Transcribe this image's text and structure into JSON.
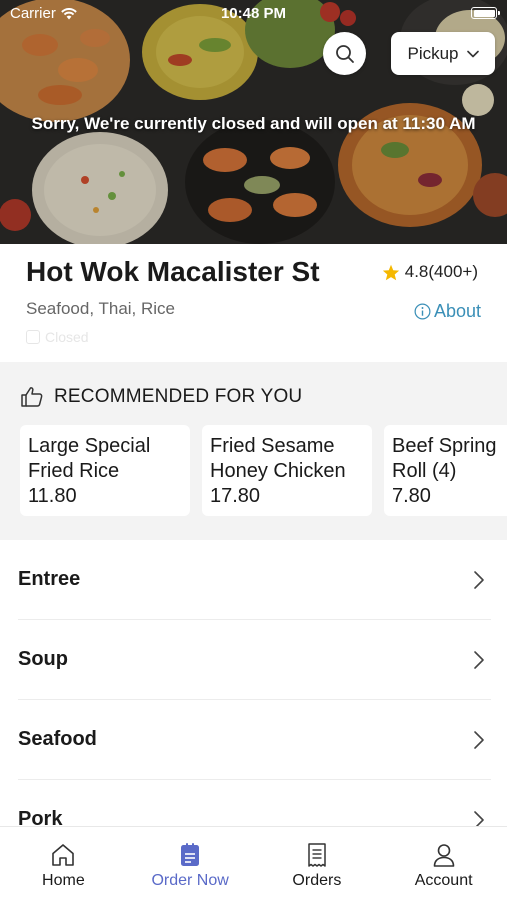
{
  "status_bar": {
    "carrier": "Carrier",
    "time": "10:48 PM"
  },
  "hero": {
    "closed_message": "Sorry, We're currently closed and will open at 11:30 AM",
    "pickup_label": "Pickup"
  },
  "restaurant": {
    "name": "Hot Wok Macalister St",
    "rating": "4.8(400+)",
    "cuisine": "Seafood, Thai, Rice",
    "about_label": "About",
    "closed_badge": "Closed"
  },
  "recommended": {
    "heading": "RECOMMENDED FOR YOU",
    "items": [
      {
        "title_line1": "Large Special",
        "title_line2": "Fried Rice",
        "price": "11.80"
      },
      {
        "title_line1": "Fried Sesame",
        "title_line2": "Honey Chicken",
        "price": "17.80"
      },
      {
        "title_line1": "Beef Spring",
        "title_line2": "Roll (4)",
        "price": "7.80"
      }
    ]
  },
  "menu": {
    "categories": [
      "Entree",
      "Soup",
      "Seafood",
      "Pork"
    ]
  },
  "tabbar": {
    "tabs": [
      {
        "label": "Home",
        "icon": "home-icon"
      },
      {
        "label": "Order Now",
        "icon": "order-icon",
        "active": true
      },
      {
        "label": "Orders",
        "icon": "receipt-icon"
      },
      {
        "label": "Account",
        "icon": "account-icon"
      }
    ]
  },
  "colors": {
    "accent": "#5a6ac8",
    "link": "#3a8fb7",
    "star": "#f5b800",
    "section_bg": "#f3f3f3"
  }
}
